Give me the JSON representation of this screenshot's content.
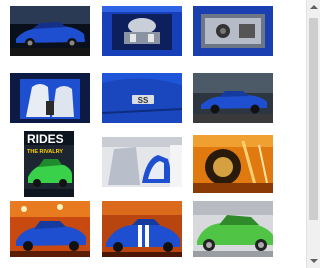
{
  "gallery": {
    "thumbnails": [
      {
        "name": "blue-muscle-car-side-outdoor"
      },
      {
        "name": "engine-bay"
      },
      {
        "name": "trunk-speaker-box"
      },
      {
        "name": "interior-seats"
      },
      {
        "name": "ss-badge-fender"
      },
      {
        "name": "blue-car-profile-outdoor"
      },
      {
        "name": "magazine-cover",
        "cover_title": "RIDES",
        "cover_subtitle": "THE RIVALRY"
      },
      {
        "name": "interior-door-open"
      },
      {
        "name": "wheel-close-up-orange"
      },
      {
        "name": "blue-car-showroom-front"
      },
      {
        "name": "blue-car-showroom-angle"
      },
      {
        "name": "green-car-show"
      }
    ]
  },
  "colors": {
    "car_blue": "#1f4fd1",
    "scrollbar_track": "#f0f0f0",
    "scrollbar_thumb": "#cdcdcd"
  }
}
